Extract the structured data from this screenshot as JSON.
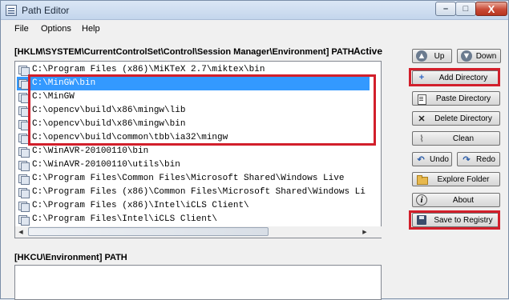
{
  "window": {
    "title": "Path Editor",
    "controls": {
      "minimize": "–",
      "maximize": "□",
      "close": "X"
    }
  },
  "menu": [
    "File",
    "Options",
    "Help"
  ],
  "hklm": {
    "title": "[HKLM\\SYSTEM\\CurrentControlSet\\Control\\Session Manager\\Environment] PATH",
    "active_label": "Active",
    "rows": [
      {
        "text": "C:\\Program Files (x86)\\MiKTeX 2.7\\miktex\\bin",
        "selected": false
      },
      {
        "text": "C:\\MinGW\\bin",
        "selected": true
      },
      {
        "text": "C:\\MinGW",
        "selected": false
      },
      {
        "text": "C:\\opencv\\build\\x86\\mingw\\lib",
        "selected": false
      },
      {
        "text": "C:\\opencv\\build\\x86\\mingw\\bin",
        "selected": false
      },
      {
        "text": "C:\\opencv\\build\\common\\tbb\\ia32\\mingw",
        "selected": false
      },
      {
        "text": "C:\\WinAVR-20100110\\bin",
        "selected": false
      },
      {
        "text": "C:\\WinAVR-20100110\\utils\\bin",
        "selected": false
      },
      {
        "text": "C:\\Program Files\\Common Files\\Microsoft Shared\\Windows Live",
        "selected": false
      },
      {
        "text": "C:\\Program Files (x86)\\Common Files\\Microsoft Shared\\Windows Li",
        "selected": false
      },
      {
        "text": "C:\\Program Files (x86)\\Intel\\iCLS Client\\",
        "selected": false
      },
      {
        "text": "C:\\Program Files\\Intel\\iCLS Client\\",
        "selected": false
      }
    ]
  },
  "hkcu": {
    "title": "[HKCU\\Environment] PATH"
  },
  "buttons": {
    "up": "Up",
    "down": "Down",
    "add_directory": "Add Directory",
    "paste_directory": "Paste Directory",
    "delete_directory": "Delete Directory",
    "clean": "Clean",
    "undo": "Undo",
    "redo": "Redo",
    "explore_folder": "Explore Folder",
    "about": "About",
    "save_to_registry": "Save to Registry"
  },
  "icons": {
    "up": "arrow-up-icon",
    "down": "arrow-down-icon",
    "add_directory": "plus-icon",
    "paste_directory": "paste-icon",
    "delete_directory": "x-icon",
    "clean": "broom-icon",
    "undo": "undo-icon",
    "redo": "redo-icon",
    "explore_folder": "folder-icon",
    "about": "info-icon",
    "save_to_registry": "save-icon"
  },
  "colors": {
    "highlight_frame": "#d21f2b",
    "selection": "#3399ff",
    "window_bg": "#f0f0f0"
  }
}
